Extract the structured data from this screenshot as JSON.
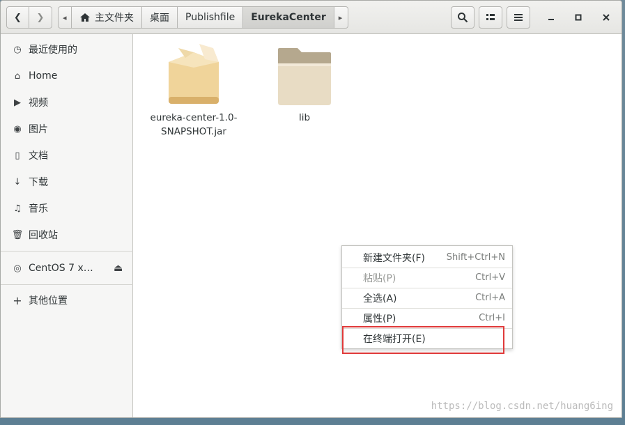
{
  "header": {
    "back_glyph": "❮",
    "forward_glyph": "❯",
    "path_left_glyph": "◂",
    "path_right_glyph": "▸",
    "breadcrumbs": [
      {
        "label": "主文件夹"
      },
      {
        "label": "桌面"
      },
      {
        "label": "Publishfile"
      },
      {
        "label": "EurekaCenter"
      }
    ],
    "search_glyph": "🔍",
    "view_glyph": "▦",
    "menu_glyph": "☰",
    "minimize_glyph": "–",
    "maximize_glyph": "▪",
    "close_glyph": "✕"
  },
  "sidebar": {
    "items": [
      {
        "label": "最近使用的",
        "icon": "clock-icon",
        "glyph": "◷"
      },
      {
        "label": "Home",
        "icon": "home-icon",
        "glyph": "⌂"
      },
      {
        "label": "视频",
        "icon": "video-icon",
        "glyph": "▶"
      },
      {
        "label": "图片",
        "icon": "camera-icon",
        "glyph": "◉"
      },
      {
        "label": "文档",
        "icon": "document-icon",
        "glyph": "▯"
      },
      {
        "label": "下载",
        "icon": "download-icon",
        "glyph": "↓"
      },
      {
        "label": "音乐",
        "icon": "music-icon",
        "glyph": "♫"
      },
      {
        "label": "回收站",
        "icon": "trash-icon",
        "glyph": "🗑"
      }
    ],
    "devices": [
      {
        "label": "CentOS 7 x…",
        "icon": "disc-icon",
        "glyph": "◎",
        "eject_glyph": "⏏"
      }
    ],
    "other": {
      "label": "其他位置",
      "glyph": "+"
    }
  },
  "files": [
    {
      "name_line1": "eureka-center-1.0-",
      "name_line2": "SNAPSHOT.jar",
      "icon": "package-icon"
    },
    {
      "name_line1": "lib",
      "name_line2": "",
      "icon": "folder-icon"
    }
  ],
  "context_menu": {
    "items": [
      {
        "label": "新建文件夹(F)",
        "accel": "Shift+Ctrl+N",
        "enabled": true
      },
      {
        "label": "粘贴(P)",
        "accel": "Ctrl+V",
        "enabled": false
      },
      {
        "label": "全选(A)",
        "accel": "Ctrl+A",
        "enabled": true
      },
      {
        "label": "属性(P)",
        "accel": "Ctrl+I",
        "enabled": true
      },
      {
        "label": "在终端打开(E)",
        "accel": "",
        "enabled": true
      }
    ]
  },
  "watermark": "https://blog.csdn.net/huang6ing",
  "colors": {
    "highlight": "#e03a3a",
    "folder": "#e8dcc4",
    "package": "#e8c98a"
  }
}
